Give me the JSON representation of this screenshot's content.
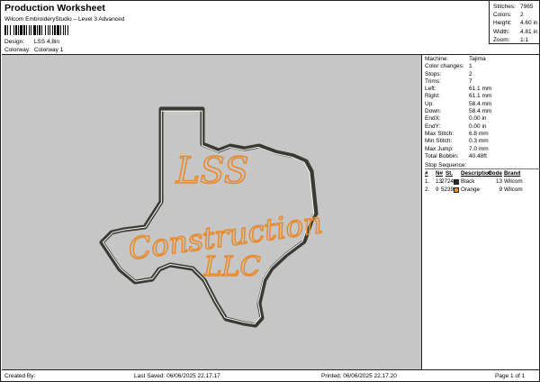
{
  "header": {
    "title": "Production Worksheet",
    "subtitle": "Wilcom EmbroideryStudio – Level 3 Advanced",
    "design_label": "Design:",
    "design_value": "LSS 4,8in",
    "colorway_label": "Colorway:",
    "colorway_value": "Colorway 1"
  },
  "stats": [
    {
      "label": "Stitches:",
      "value": "7965"
    },
    {
      "label": "Colors:",
      "value": "2"
    },
    {
      "label": "Height:",
      "value": "4.60 in"
    },
    {
      "label": "Width:",
      "value": "4.81 in"
    },
    {
      "label": "Zoom:",
      "value": "1:1"
    }
  ],
  "machine_info": [
    {
      "label": "Machine:",
      "value": "Tajima"
    },
    {
      "label": "Color changes:",
      "value": "1"
    },
    {
      "label": "Stops:",
      "value": "2"
    },
    {
      "label": "Trims:",
      "value": "7"
    },
    {
      "label": "Left:",
      "value": "61.1 mm"
    },
    {
      "label": "Right:",
      "value": "61.1 mm"
    },
    {
      "label": "Up:",
      "value": "58.4 mm"
    },
    {
      "label": "Down:",
      "value": "58.4 mm"
    },
    {
      "label": "EndX:",
      "value": "0.00 in"
    },
    {
      "label": "EndY:",
      "value": "0.00 in"
    },
    {
      "label": "Max Stitch:",
      "value": "6.8 mm"
    },
    {
      "label": "Min Stitch:",
      "value": "0.3 mm"
    },
    {
      "label": "Max Jump:",
      "value": "7.0 mm"
    },
    {
      "label": "Total Bobbin:",
      "value": "40.48ft"
    }
  ],
  "stop_sequence": {
    "title": "Stop Sequence:",
    "headers": {
      "num": "#",
      "n": "N#",
      "st": "St.",
      "desc": "Description",
      "code": "Code",
      "brand": "Brand"
    },
    "rows": [
      {
        "num": "1.",
        "n": "13",
        "st": "2724",
        "color": "#2a2a2a",
        "desc": "Black",
        "code": "13",
        "brand": "Wilcom"
      },
      {
        "num": "2.",
        "n": "9",
        "st": "5239",
        "color": "#e8892a",
        "desc": "Orange",
        "code": "9",
        "brand": "Wilcom"
      }
    ]
  },
  "design_text": {
    "line1": "LSS",
    "line2": "Construction",
    "line3": "LLC"
  },
  "colors": {
    "canvas_bg": "#c6c6c6",
    "outline_dark": "#3a3a35",
    "outline_light": "#ffffff",
    "text_orange": "#e8892a"
  },
  "footer": {
    "created_by": "Created By:",
    "last_saved": "Last Saved: 06/06/2025 22.17.17",
    "printed": "Printed: 06/06/2025 22.17.20",
    "page": "Page 1 of 1"
  }
}
